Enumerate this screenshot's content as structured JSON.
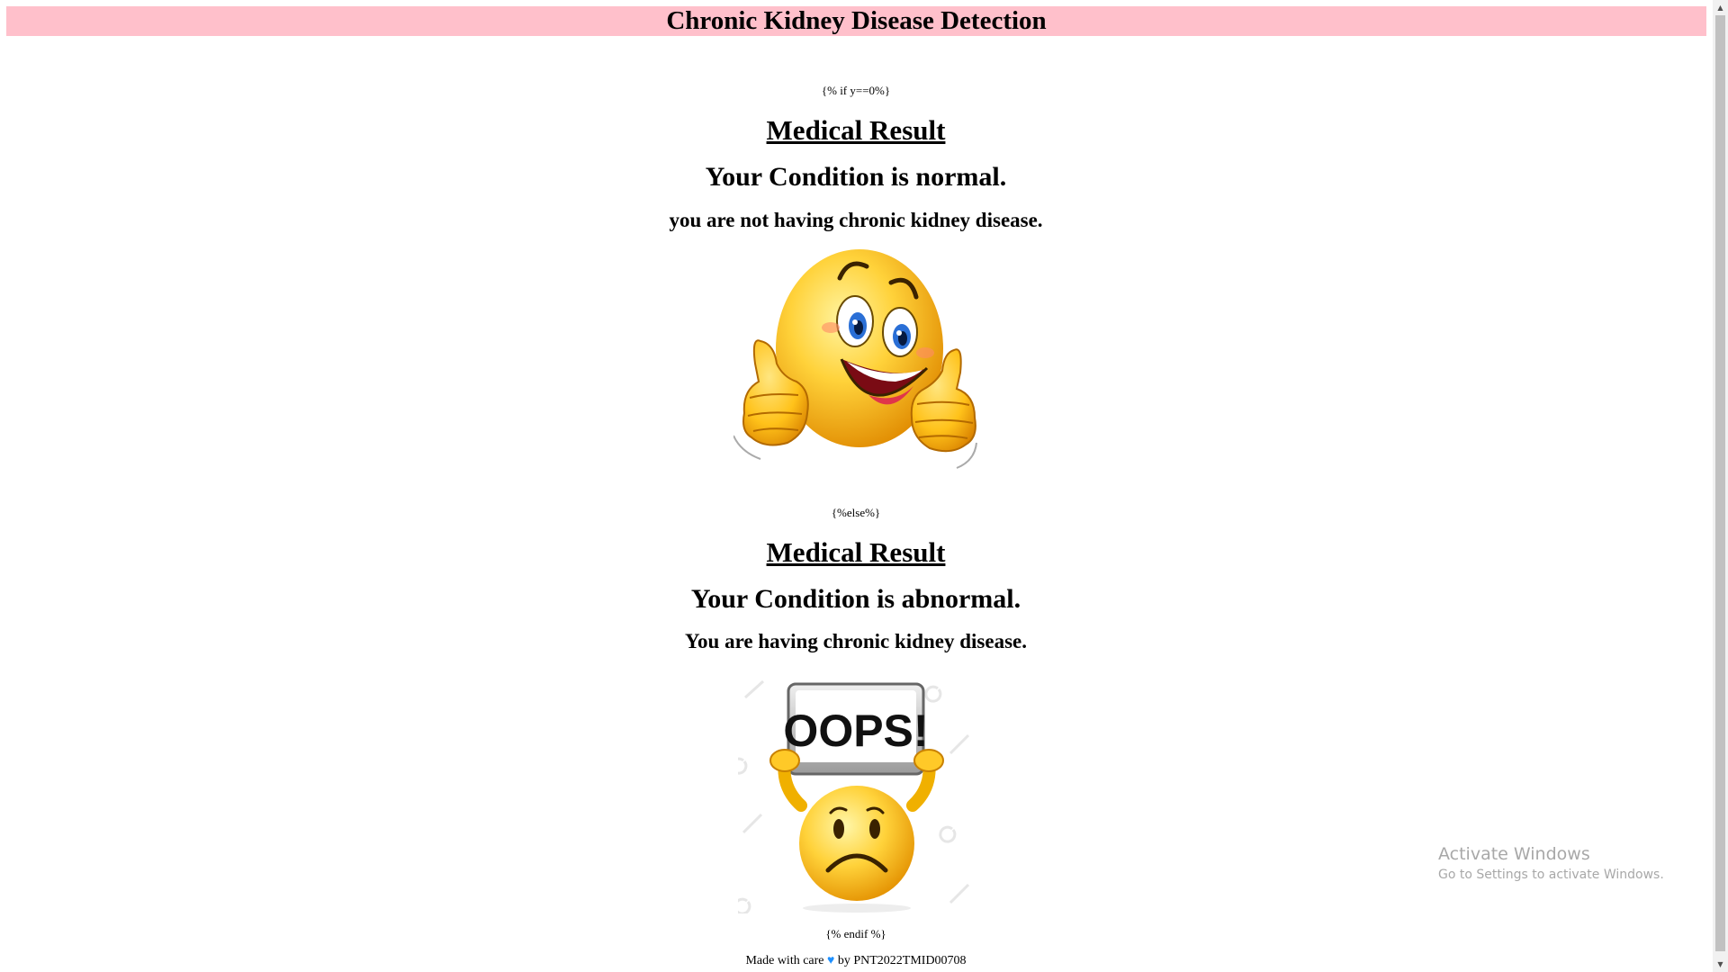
{
  "header": {
    "title": "Chronic Kidney Disease Detection"
  },
  "template_if": "{% if y==0%}",
  "normal": {
    "heading": "Medical Result",
    "condition": "Your Condition is normal.",
    "message": "you are not having chronic kidney disease.",
    "image_icon": "happy-thumbs-up-emoji"
  },
  "template_else": "{%else%}",
  "abnormal": {
    "heading": "Medical Result",
    "condition": "Your Condition is abnormal.",
    "message": "You are having chronic kidney disease.",
    "image_icon": "sad-oops-sign-emoji",
    "sign_text": "OOPS!"
  },
  "template_endif": "{% endif %}",
  "footer": {
    "prefix": "Made with care",
    "heart": "♥",
    "suffix": "by PNT2022TMID00708"
  },
  "watermark": {
    "title": "Activate Windows",
    "subtitle": "Go to Settings to activate Windows."
  },
  "colors": {
    "header_bg": "#ffc0cb",
    "heart": "#1e90ff"
  }
}
